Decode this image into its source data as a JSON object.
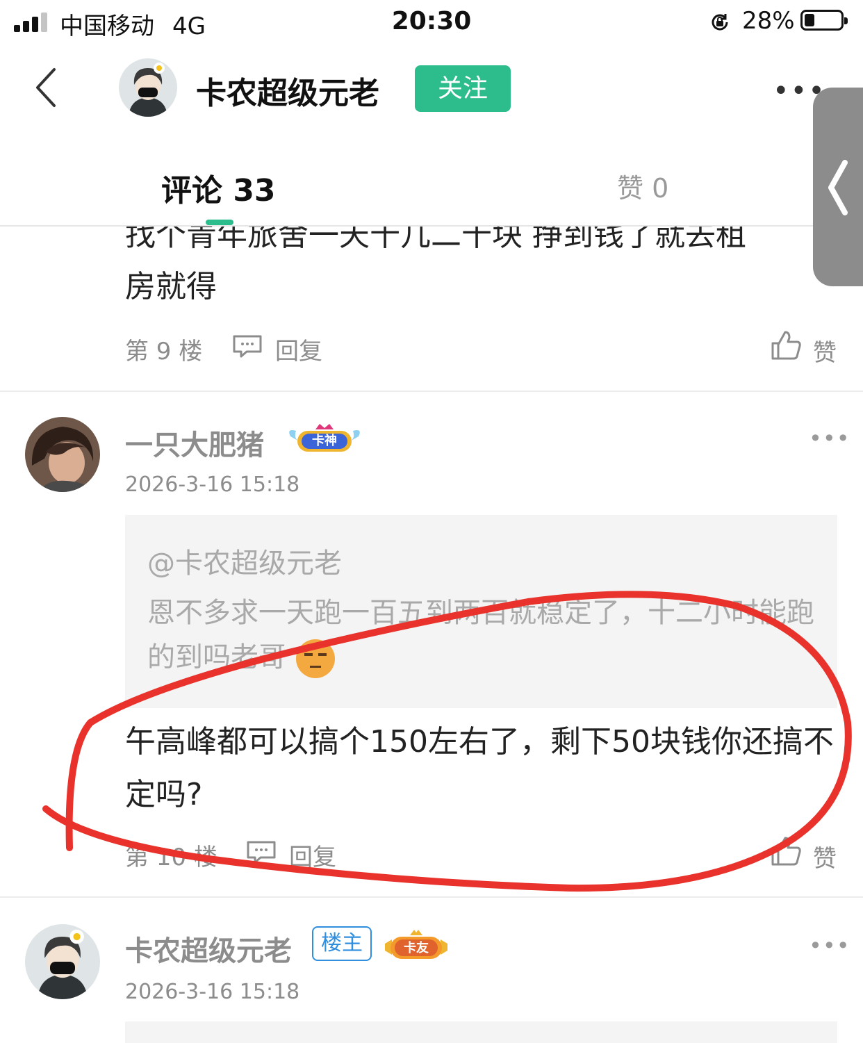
{
  "status_bar": {
    "carrier": "中国移动",
    "network": "4G",
    "time": "20:30",
    "battery_percent": "28%",
    "battery_level": 0.28
  },
  "header": {
    "title": "卡农超级元老",
    "follow_label": "关注",
    "accent_color": "#2dbd8c"
  },
  "tabs": {
    "comments_label": "评论 33",
    "likes_label": "赞 0"
  },
  "comments": [
    {
      "text_partial": "找个青年旅舍一天十几二十块 挣到钱了就去租",
      "text": "房就得",
      "floor": "第 9 楼",
      "reply_label": "回复",
      "like_label": "赞"
    },
    {
      "author": "一只大肥猪",
      "badge": "卡神",
      "date": "2026-3-16 15:18",
      "quote_at": "@卡农超级元老",
      "quote_text": "恩不多求一天跑一百五到两百就稳定了，十二小时能跑的到吗老哥",
      "text": "午高峰都可以搞个150左右了，剩下50块钱你还搞不定吗?",
      "floor": "第 10 楼",
      "reply_label": "回复",
      "like_label": "赞"
    },
    {
      "author": "卡农超级元老",
      "owner_badge": "楼主",
      "badge": "卡友",
      "date": "2026-3-16 15:18"
    }
  ],
  "icons": [
    "signal-icon",
    "screen-lock-icon",
    "battery-icon",
    "back-icon",
    "more-icon",
    "reply-icon",
    "thumb-up-icon",
    "side-handle-chevron-icon"
  ],
  "annotation_color": "#e8322b"
}
